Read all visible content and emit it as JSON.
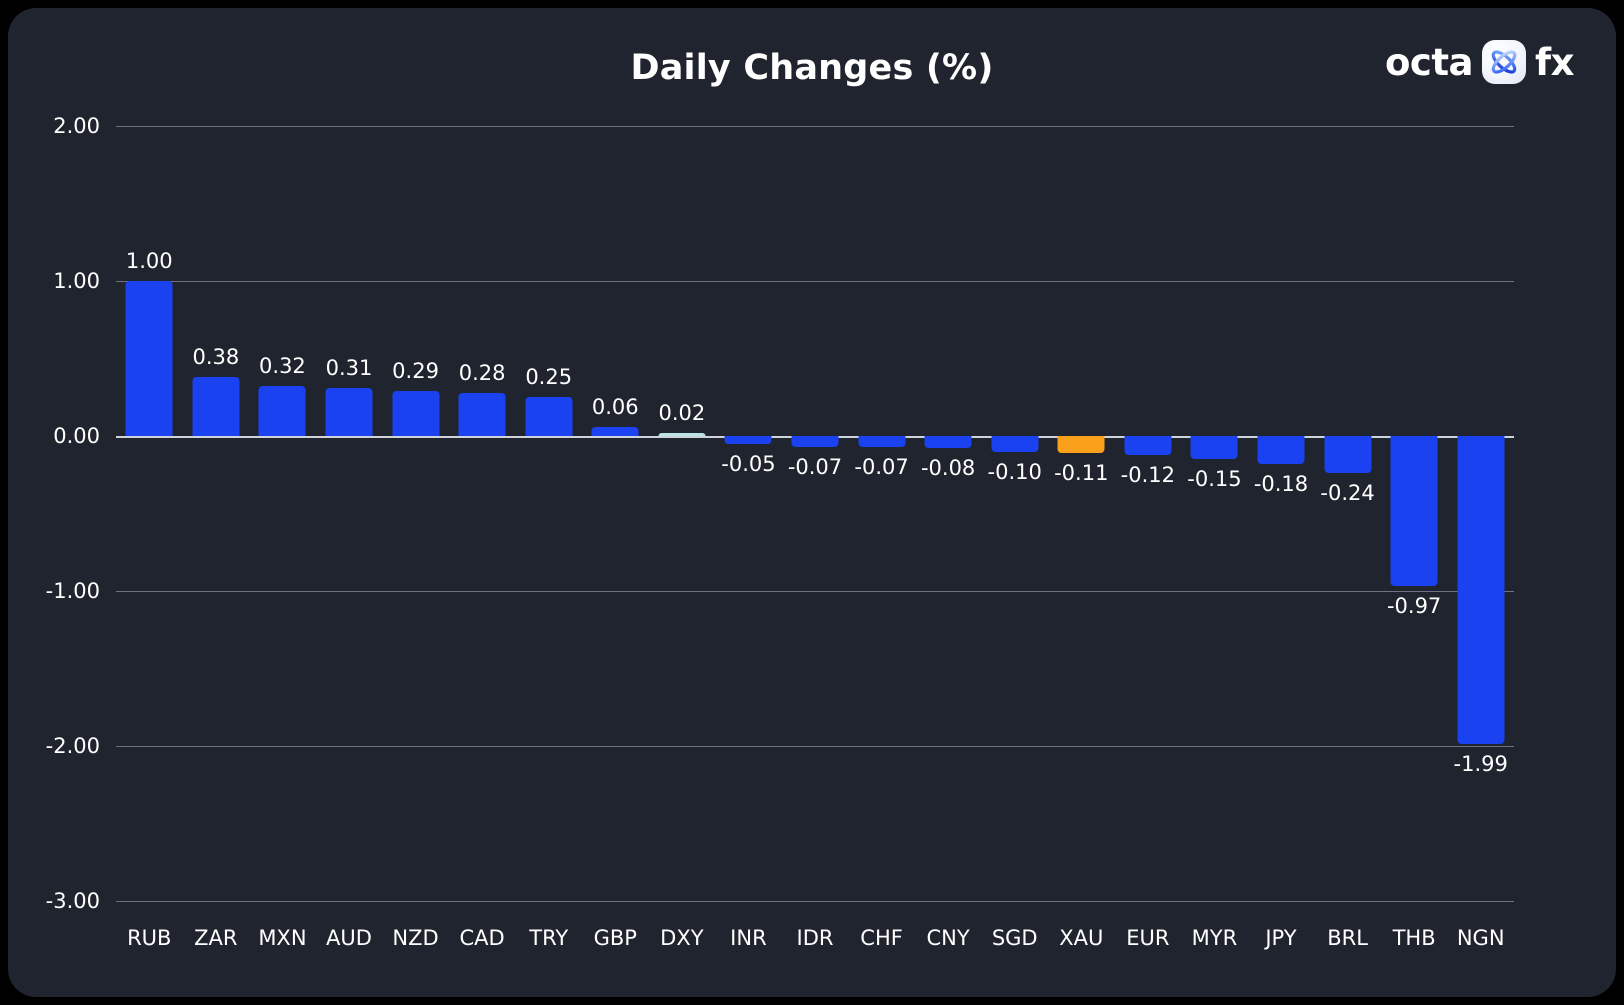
{
  "card": {
    "background": "#20242e",
    "page_background": "#000000"
  },
  "header": {
    "title": "Daily Changes (%)",
    "brand": {
      "word_left": "octa",
      "word_right": "fx",
      "mark_icon": "octa-atom-icon"
    }
  },
  "chart_data": {
    "type": "bar",
    "title": "Daily Changes (%)",
    "xlabel": "",
    "ylabel": "",
    "ylim": [
      -3.0,
      2.0
    ],
    "yticks": [
      2.0,
      1.0,
      0.0,
      -1.0,
      -2.0,
      -3.0
    ],
    "ytick_labels": [
      "2.00",
      "1.00",
      "0.00",
      "-1.00",
      "-2.00",
      "-3.00"
    ],
    "grid": true,
    "legend": "none",
    "zero_line": true,
    "categories": [
      "RUB",
      "ZAR",
      "MXN",
      "AUD",
      "NZD",
      "CAD",
      "TRY",
      "GBP",
      "DXY",
      "INR",
      "IDR",
      "CHF",
      "CNY",
      "SGD",
      "XAU",
      "EUR",
      "MYR",
      "JPY",
      "BRL",
      "THB",
      "NGN"
    ],
    "values": [
      1.0,
      0.38,
      0.32,
      0.31,
      0.29,
      0.28,
      0.25,
      0.06,
      0.02,
      -0.05,
      -0.07,
      -0.07,
      -0.08,
      -0.1,
      -0.11,
      -0.12,
      -0.15,
      -0.18,
      -0.24,
      -0.97,
      -1.99
    ],
    "value_labels": [
      "1.00",
      "0.38",
      "0.32",
      "0.31",
      "0.29",
      "0.28",
      "0.25",
      "0.06",
      "0.02",
      "-0.05",
      "-0.07",
      "-0.07",
      "-0.08",
      "-0.10",
      "-0.11",
      "-0.12",
      "-0.15",
      "-0.18",
      "-0.24",
      "-0.97",
      "-1.99"
    ],
    "bar_colors": [
      "#1a42f0",
      "#1a42f0",
      "#1a42f0",
      "#1a42f0",
      "#1a42f0",
      "#1a42f0",
      "#1a42f0",
      "#1a42f0",
      "#b9e4e6",
      "#1a42f0",
      "#1a42f0",
      "#1a42f0",
      "#1a42f0",
      "#1a42f0",
      "#fba01a",
      "#1a42f0",
      "#1a42f0",
      "#1a42f0",
      "#1a42f0",
      "#1a42f0",
      "#1a42f0"
    ],
    "colors": {
      "default_bar": "#1a42f0",
      "highlight_bar": "#fba01a",
      "dxy_bar": "#b9e4e6",
      "gridline": "#6e7381",
      "zero_line": "#cfd3da",
      "text": "#ffffff"
    }
  }
}
